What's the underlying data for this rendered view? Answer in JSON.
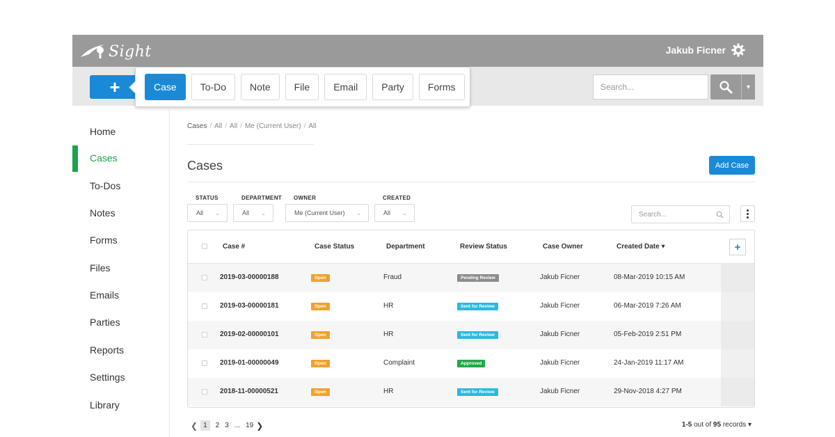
{
  "app": {
    "logo_text": "Sight",
    "user_name": "Jakub Ficner"
  },
  "toolbar": {
    "new_button_label": "+",
    "quick_create": [
      "Case",
      "To-Do",
      "Note",
      "File",
      "Email",
      "Party",
      "Forms"
    ],
    "search_placeholder": "Search..."
  },
  "sidebar": {
    "items": [
      "Home",
      "Cases",
      "To-Dos",
      "Notes",
      "Forms",
      "Files",
      "Emails",
      "Parties",
      "Reports",
      "Settings",
      "Library"
    ],
    "active": "Cases"
  },
  "main": {
    "breadcrumb": [
      "Cases",
      "All",
      "All",
      "Me (Current User)",
      "All"
    ],
    "title": "Cases",
    "add_button": "Add Case",
    "filters": [
      {
        "label": "STATUS",
        "value": "All"
      },
      {
        "label": "DEPARTMENT",
        "value": "All"
      },
      {
        "label": "OWNER",
        "value": "Me (Current User)"
      },
      {
        "label": "CREATED",
        "value": "All"
      }
    ],
    "list_search_placeholder": "Search...",
    "columns": [
      "Case #",
      "Case Status",
      "Department",
      "Review Status",
      "Case Owner",
      "Created Date"
    ],
    "sort_indicator": "▾",
    "add_column_label": "+",
    "rows": [
      {
        "case_no": "2019-03-00000188",
        "status": "Open",
        "department": "Fraud",
        "review": "Pending Review",
        "owner": "Jakub Ficner",
        "created": "08-Mar-2019 10:15 AM"
      },
      {
        "case_no": "2019-03-00000181",
        "status": "Open",
        "department": "HR",
        "review": "Sent for Review",
        "owner": "Jakub Ficner",
        "created": "06-Mar-2019 7:26 AM"
      },
      {
        "case_no": "2019-02-00000101",
        "status": "Open",
        "department": "HR",
        "review": "Sent for Review",
        "owner": "Jakub Ficner",
        "created": "05-Feb-2019 2:51 PM"
      },
      {
        "case_no": "2019-01-00000049",
        "status": "Open",
        "department": "Complaint",
        "review": "Approved",
        "owner": "Jakub Ficner",
        "created": "24-Jan-2019 11:17 AM"
      },
      {
        "case_no": "2018-11-00000521",
        "status": "Open",
        "department": "HR",
        "review": "Sent for Review",
        "owner": "Jakub Ficner",
        "created": "29-Nov-2018 4:27 PM"
      }
    ],
    "pagination": {
      "pages": [
        "1",
        "2",
        "3",
        "...",
        "19"
      ],
      "current": "1",
      "range": "1-5",
      "out_of_text": "out of",
      "total": "95",
      "records_text": "records"
    }
  },
  "colors": {
    "primary": "#1a8ad6",
    "active_nav": "#1aa34a",
    "header_bg": "#9a9a9a",
    "status_open": "#f0a22b",
    "review_pending": "#8c8c8c",
    "review_sent": "#2bb8e0",
    "review_approved": "#22a84a"
  }
}
